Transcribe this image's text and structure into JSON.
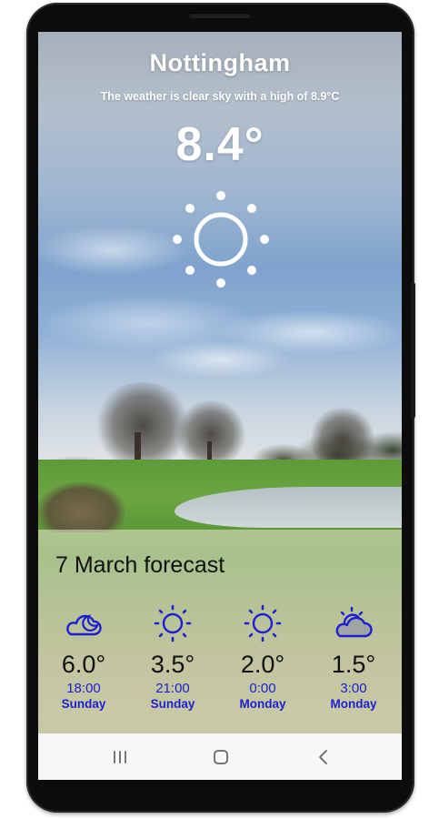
{
  "current": {
    "city": "Nottingham",
    "summary": "The weather is clear sky with a high of 8.9°C",
    "temperature": "8.4°",
    "icon": "sun-icon"
  },
  "forecast": {
    "title": "7 March forecast",
    "items": [
      {
        "temp": "6.0°",
        "time": "18:00",
        "day": "Sunday",
        "icon": "cloudy-night-icon"
      },
      {
        "temp": "3.5°",
        "time": "21:00",
        "day": "Sunday",
        "icon": "sun-icon"
      },
      {
        "temp": "2.0°",
        "time": "0:00",
        "day": "Monday",
        "icon": "sun-icon"
      },
      {
        "temp": "1.5°",
        "time": "3:00",
        "day": "Monday",
        "icon": "partly-cloudy-icon"
      }
    ]
  },
  "navbar": {
    "items": [
      "recent-apps-icon",
      "home-icon",
      "back-icon"
    ]
  },
  "colors": {
    "forecast_accent": "#1d1fd0",
    "text_dark": "#111111",
    "overlay_text": "#ffffff"
  }
}
